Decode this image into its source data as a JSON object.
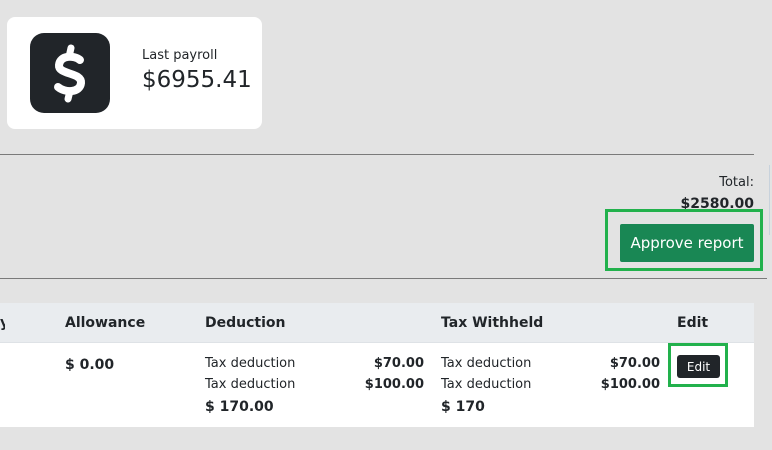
{
  "payroll_card": {
    "label": "Last payroll",
    "value": "$6955.41",
    "icon": "dollar-sign-icon"
  },
  "summary": {
    "total_label": "Total:",
    "total_value": "$2580.00",
    "approve_label": "Approve report"
  },
  "table": {
    "cut_header_fragment": "y",
    "headers": {
      "allowance": "Allowance",
      "deduction": "Deduction",
      "tax_withheld": "Tax Withheld",
      "edit": "Edit"
    },
    "row": {
      "allowance": "$ 0.00",
      "deductions": [
        {
          "label": "Tax deduction",
          "amount": "$70.00"
        },
        {
          "label": "Tax deduction",
          "amount": "$100.00"
        }
      ],
      "deduction_total": "$ 170.00",
      "tax_withheld": [
        {
          "label": "Tax deduction",
          "amount": "$70.00"
        },
        {
          "label": "Tax deduction",
          "amount": "$100.00"
        }
      ],
      "tax_total": "$ 170",
      "edit_label": "Edit"
    }
  },
  "colors": {
    "primary_green": "#198754",
    "highlight_green": "#22b14c",
    "dark": "#212529"
  }
}
